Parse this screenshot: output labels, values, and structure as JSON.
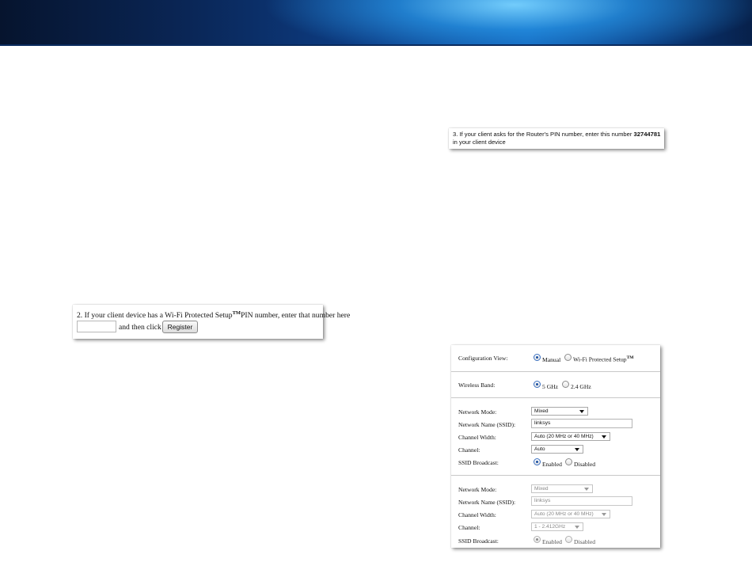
{
  "pin_snippet": {
    "text_before": "3. If your client asks for the Router's PIN number, enter this number ",
    "pin_number": "32744781",
    "text_after": " in your client device"
  },
  "register_snippet": {
    "line1_text": "2. If your client device has a Wi-Fi Protected Setup",
    "tm_mark": "TM",
    "line1_suffix": "PIN number, enter that number here",
    "pin_input_value": "",
    "then_text": "and then click",
    "register_button": "Register"
  },
  "wireless_panel": {
    "config_view_label": "Configuration View:",
    "config_options": [
      "Manual",
      "Wi-Fi Protected Setup"
    ],
    "config_tm": "TM",
    "config_selected": "Manual",
    "band_label": "Wireless Band:",
    "band_options": [
      "5 GHz",
      "2.4 GHz"
    ],
    "band_selected": "5 GHz",
    "section_5ghz": {
      "network_mode_label": "Network Mode:",
      "network_mode_value": "Mixed",
      "ssid_label": "Network Name (SSID):",
      "ssid_value": "linksys",
      "channel_width_label": "Channel Width:",
      "channel_width_value": "Auto (20 MHz or 40 MHz)",
      "channel_label": "Channel:",
      "channel_value": "Auto",
      "ssid_broadcast_label": "SSID Broadcast:",
      "broadcast_options": [
        "Enabled",
        "Disabled"
      ],
      "broadcast_selected": "Enabled"
    },
    "section_24ghz": {
      "network_mode_label": "Network Mode:",
      "network_mode_value": "Mixed",
      "ssid_label": "Network Name (SSID):",
      "ssid_value": "linksys",
      "channel_width_label": "Channel Width:",
      "channel_width_value": "Auto (20 MHz or 40 MHz)",
      "channel_label": "Channel:",
      "channel_value": "1 - 2.412GHz",
      "ssid_broadcast_label": "SSID Broadcast:",
      "broadcast_options": [
        "Enabled",
        "Disabled"
      ],
      "broadcast_selected": "Enabled",
      "disabled": true
    }
  },
  "colors": {
    "banner_dark": "#06142e",
    "banner_light": "#1060b8",
    "radio_selected": "#1a4fa0"
  }
}
